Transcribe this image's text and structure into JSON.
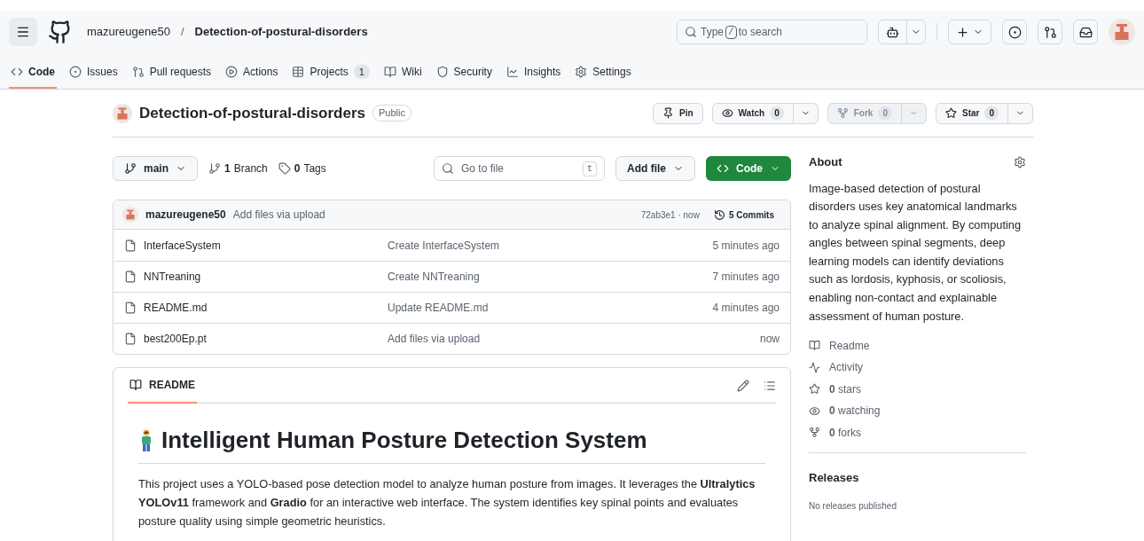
{
  "header": {
    "owner": "mazureugene50",
    "separator": "/",
    "repo": "Detection-of-postural-disorders",
    "search_placeholder_before": "Type",
    "search_key": "/",
    "search_placeholder_after": "to search"
  },
  "nav_tabs": [
    {
      "label": "Code",
      "selected": true
    },
    {
      "label": "Issues",
      "selected": false
    },
    {
      "label": "Pull requests",
      "selected": false
    },
    {
      "label": "Actions",
      "selected": false
    },
    {
      "label": "Projects",
      "count": "1",
      "selected": false
    },
    {
      "label": "Wiki",
      "selected": false
    },
    {
      "label": "Security",
      "selected": false
    },
    {
      "label": "Insights",
      "selected": false
    },
    {
      "label": "Settings",
      "selected": false
    }
  ],
  "repo_title": {
    "name": "Detection-of-postural-disorders",
    "visibility": "Public"
  },
  "repo_actions": [
    {
      "label": "Pin",
      "kind": "pin"
    },
    {
      "label": "Watch",
      "count": "0",
      "kind": "watch",
      "disabled": false
    },
    {
      "label": "Fork",
      "count": "0",
      "kind": "fork",
      "disabled": true
    },
    {
      "label": "Star",
      "count": "0",
      "kind": "star",
      "disabled": false
    }
  ],
  "branch_bar": {
    "branch": "main",
    "branches_count": "1",
    "branches_label": "Branch",
    "tags_count": "0",
    "tags_label": "Tags",
    "goto_placeholder": "Go to file",
    "goto_key": "t",
    "add_file": "Add file",
    "code": "Code"
  },
  "latest_commit": {
    "author": "mazureugene50",
    "message": "Add files via upload",
    "hash_time": "72ab3e1 · now",
    "commits": "5 Commits"
  },
  "files": [
    {
      "name": "InterfaceSystem",
      "message": "Create InterfaceSystem",
      "time": "5 minutes ago"
    },
    {
      "name": "NNTreaning",
      "message": "Create NNTreaning",
      "time": "7 minutes ago"
    },
    {
      "name": "README.md",
      "message": "Update README.md",
      "time": "4 minutes ago"
    },
    {
      "name": "best200Ep.pt",
      "message": "Add files via upload",
      "time": "now"
    }
  ],
  "readme": {
    "tab": "README",
    "title": "Intelligent Human Posture Detection System",
    "paragraph": "This project uses a YOLO-based pose detection model to analyze human posture from images. It leverages the **Ultralytics YOLOv11** framework and **Gradio** for an interactive web interface. The system identifies key spinal points and evaluates posture quality using simple geometric heuristics."
  },
  "about": {
    "title": "About",
    "description": "Image-based detection of postural disorders uses key anatomical landmarks to analyze spinal alignment. By computing angles between spinal segments, deep learning models can identify deviations such as lordosis, kyphosis, or scoliosis, enabling non-contact and explainable assessment of human posture.",
    "links": [
      {
        "kind": "readme",
        "label": "Readme"
      },
      {
        "kind": "activity",
        "label": "Activity"
      },
      {
        "kind": "stars",
        "count": "0",
        "label": "stars"
      },
      {
        "kind": "watching",
        "count": "0",
        "label": "watching"
      },
      {
        "kind": "forks",
        "count": "0",
        "label": "forks"
      }
    ]
  },
  "releases": {
    "title": "Releases",
    "note": "No releases published"
  }
}
